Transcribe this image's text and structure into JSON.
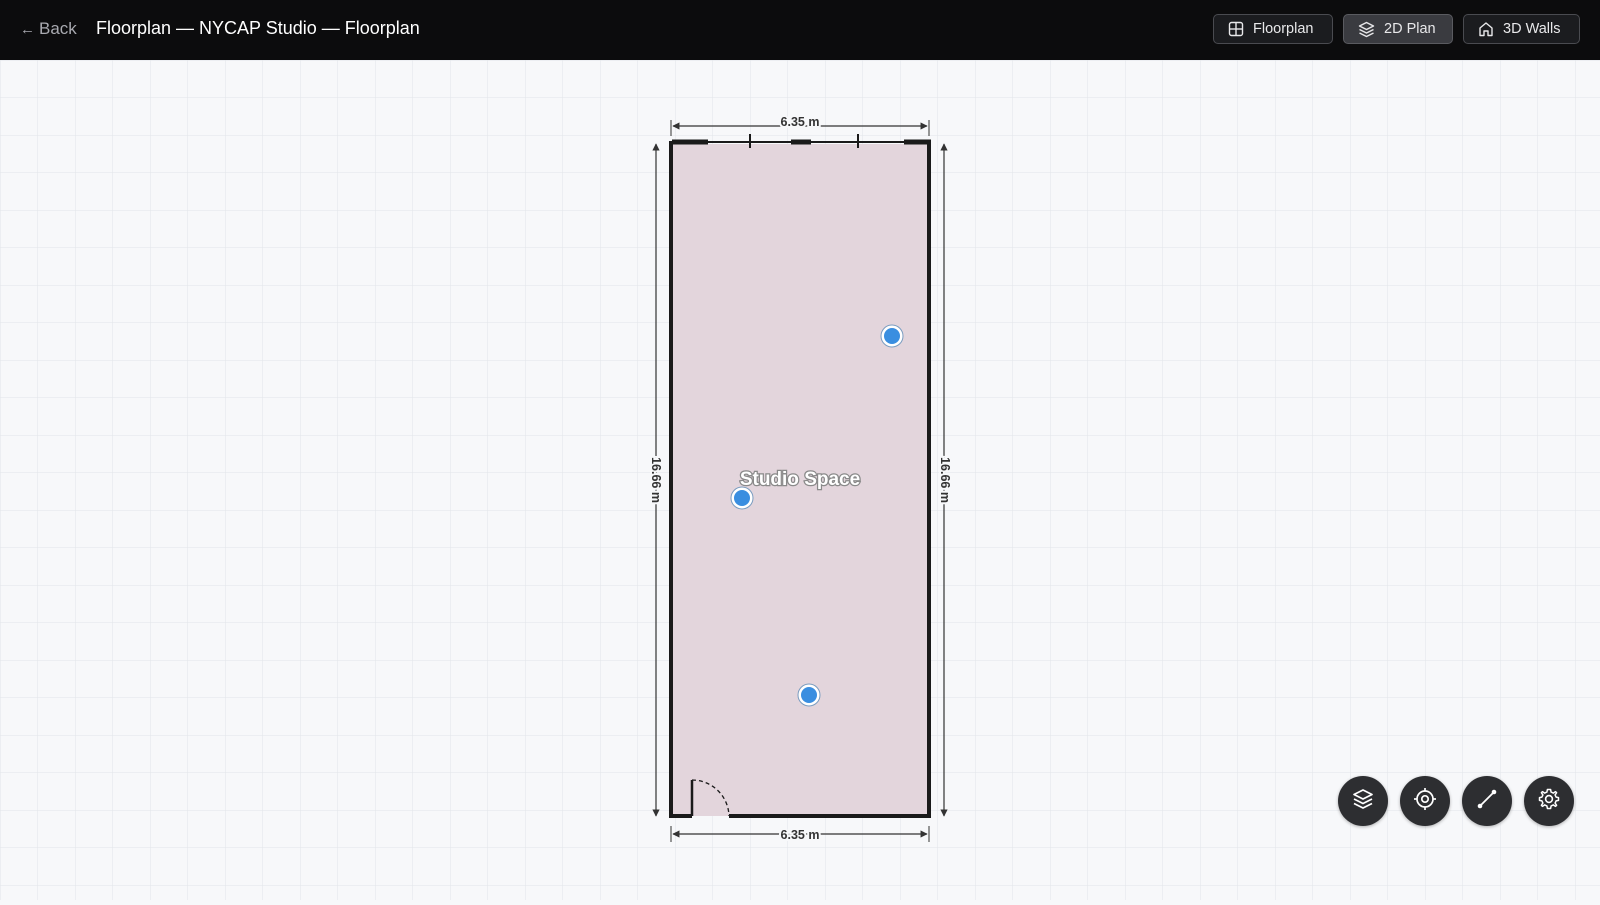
{
  "header": {
    "back_label": "Back",
    "title": "Floorplan — NYCAP Studio — Floorplan",
    "views": [
      {
        "label": "Floorplan",
        "icon": "grid-icon",
        "active": false
      },
      {
        "label": "2D Plan",
        "icon": "layers-icon",
        "active": true
      },
      {
        "label": "3D Walls",
        "icon": "home-icon",
        "active": false
      }
    ]
  },
  "floorplan": {
    "room_name": "Studio Space",
    "dim_top": "6.35 m",
    "dim_bottom": "6.35 m",
    "dim_left": "16.66 m",
    "dim_right": "16.66 m",
    "markers": 3
  },
  "tools": [
    {
      "icon": "layers-icon"
    },
    {
      "icon": "target-icon"
    },
    {
      "icon": "measure-line-icon"
    },
    {
      "icon": "gear-icon"
    }
  ],
  "colors": {
    "room_fill": "#e3d5dc",
    "wall": "#1a1a1a",
    "marker": "#3a8ee0",
    "grid": "#e3e6ea",
    "topbar": "#0c0c0d"
  }
}
